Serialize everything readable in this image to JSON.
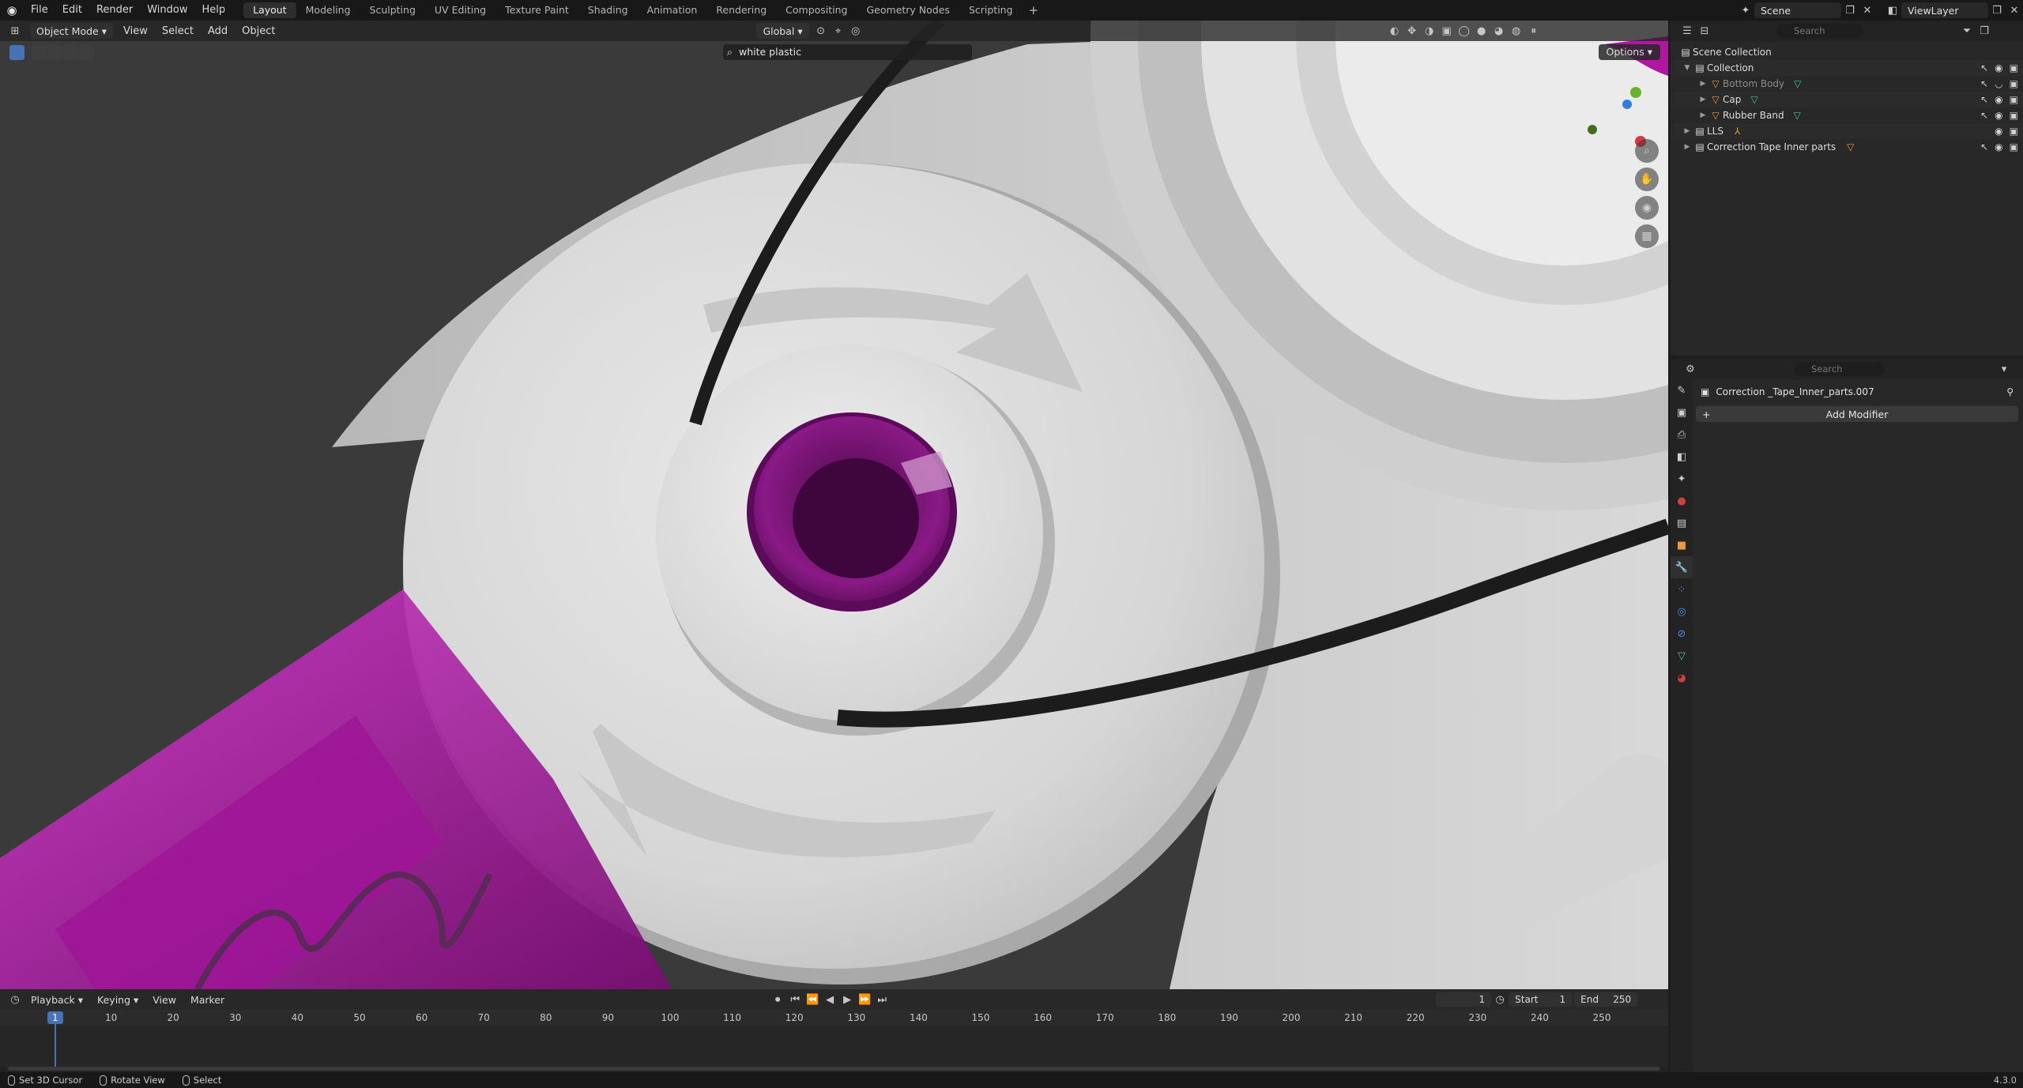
{
  "menus": [
    "File",
    "Edit",
    "Render",
    "Window",
    "Help"
  ],
  "workspaces": [
    "Layout",
    "Modeling",
    "Sculpting",
    "UV Editing",
    "Texture Paint",
    "Shading",
    "Animation",
    "Rendering",
    "Compositing",
    "Geometry Nodes",
    "Scripting"
  ],
  "active_workspace": "Layout",
  "scene_name": "Scene",
  "view_layer": "ViewLayer",
  "viewport": {
    "mode": "Object Mode",
    "menus": [
      "View",
      "Select",
      "Add",
      "Object"
    ],
    "orientation": "Global",
    "material_search": "white plastic",
    "options_label": "Options"
  },
  "outliner": {
    "search_placeholder": "Search",
    "rows": [
      {
        "label": "Scene Collection"
      },
      {
        "label": "Collection"
      },
      {
        "label": "Bottom Body"
      },
      {
        "label": "Cap"
      },
      {
        "label": "Rubber Band"
      },
      {
        "label": "LLS"
      },
      {
        "label": "Correction Tape Inner parts"
      }
    ]
  },
  "properties": {
    "search_placeholder": "Search",
    "object_name": "Correction _Tape_Inner_parts.007",
    "add_modifier": "Add Modifier"
  },
  "timeline": {
    "menus": [
      "Playback",
      "Keying",
      "View",
      "Marker"
    ],
    "current_frame": "1",
    "start_label": "Start",
    "start_value": "1",
    "end_label": "End",
    "end_value": "250",
    "ticks": [
      "10",
      "20",
      "30",
      "40",
      "50",
      "60",
      "70",
      "80",
      "90",
      "100",
      "110",
      "120",
      "130",
      "140",
      "150",
      "160",
      "170",
      "180",
      "190",
      "200",
      "210",
      "220",
      "230",
      "240",
      "250"
    ],
    "playhead": "1"
  },
  "status": {
    "items": [
      "Set 3D Cursor",
      "Rotate View",
      "Select"
    ],
    "version": "4.3.0"
  },
  "colors": {
    "accent": "#4772b3",
    "magenta": "#c21dbb",
    "mesh_icon": "#3fcc8a",
    "object_icon": "#e89a3c"
  }
}
